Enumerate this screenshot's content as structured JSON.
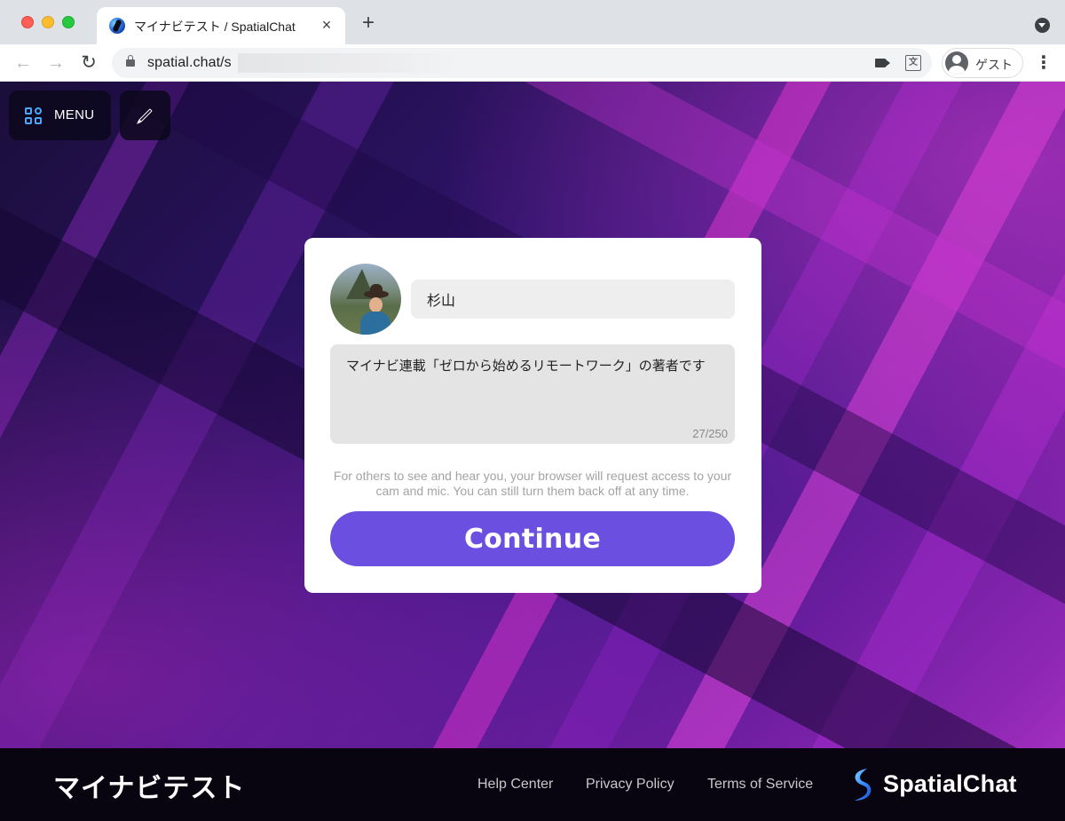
{
  "browser": {
    "tab_title": "マイナビテスト / SpatialChat",
    "tab_close": "×",
    "new_tab": "+",
    "url": "spatial.chat/s",
    "back": "←",
    "forward": "→",
    "reload": "↻",
    "translate_glyph": "文",
    "profile_name": "ゲスト",
    "menu_glyph": "⋮"
  },
  "topbar": {
    "menu_label": "MENU"
  },
  "card": {
    "name_value": "杉山",
    "bio_value": "マイナビ連載「ゼロから始めるリモートワーク」の著者です",
    "bio_counter": "27/250",
    "notice": "For others to see and hear you, your browser will request access to your cam and mic. You can still turn them back off at any time.",
    "continue_label": "Continue"
  },
  "footer": {
    "space_name": "マイナビテスト",
    "links": [
      "Help Center",
      "Privacy Policy",
      "Terms of Service"
    ],
    "brand": "SpatialChat"
  },
  "colors": {
    "accent": "#6a4fe0",
    "brand_blue": "#3b8cff",
    "footer_bg": "#090510"
  },
  "icons": [
    "spatialchat-favicon",
    "lock-icon",
    "camera-icon",
    "translate-icon",
    "profile-icon",
    "grid-menu-icon",
    "pencil-icon",
    "spatialchat-logo"
  ]
}
